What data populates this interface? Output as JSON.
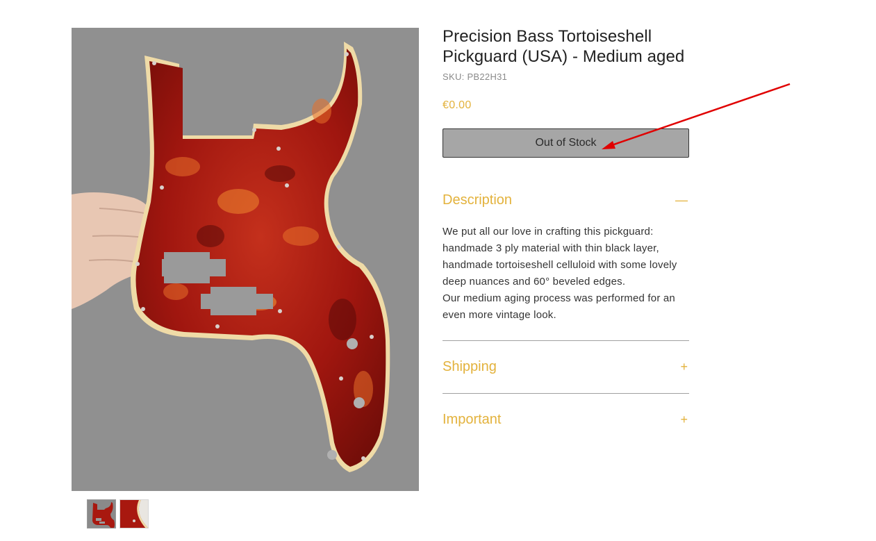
{
  "product": {
    "title_line1": "Precision Bass Tortoiseshell",
    "title_line2": "Pickguard (USA) - Medium aged",
    "sku": "SKU: PB22H31",
    "price": "€0.00",
    "stock_button": "Out of Stock"
  },
  "sections": {
    "description": {
      "label": "Description",
      "toggle": "—",
      "lines": [
        "We put all our love in crafting this pickguard:",
        "handmade 3 ply material with thin black layer,",
        "handmade tortoiseshell celluloid with some lovely",
        "deep nuances and 60° beveled edges.",
        "Our medium aging process was performed for an",
        "even more vintage look."
      ]
    },
    "shipping": {
      "label": "Shipping",
      "toggle": "+"
    },
    "important": {
      "label": "Important",
      "toggle": "+"
    }
  },
  "gallery": {
    "thumbnail_count": 2,
    "active_index": 0
  },
  "colors": {
    "accent": "#e3b23c",
    "button_bg": "#a6a6a6",
    "annotation_arrow": "#e00000"
  }
}
